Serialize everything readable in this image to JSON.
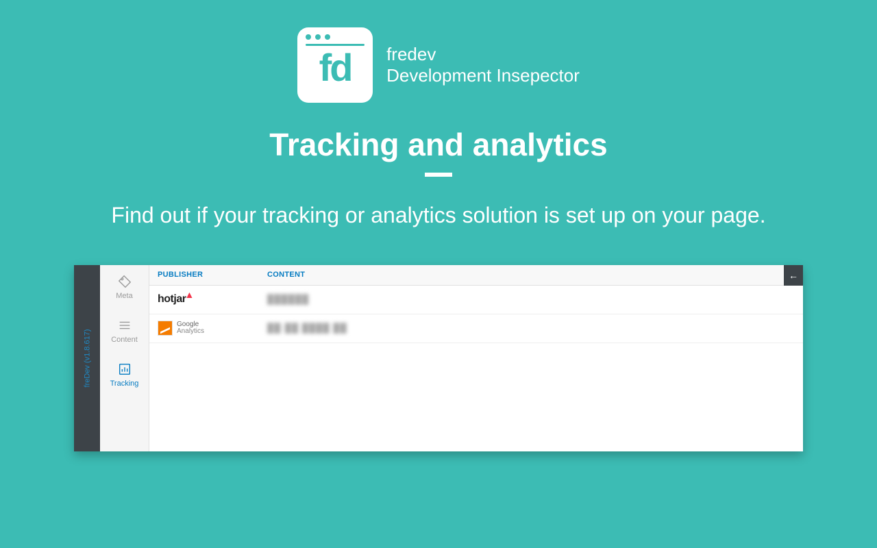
{
  "brand": {
    "line1": "fredev",
    "line2": "Development Insepector",
    "initials": "fd"
  },
  "headline": "Tracking and analytics",
  "subhead": "Find out if your tracking or analytics solution is set up on your page.",
  "sidebar": {
    "version": "freDev (v1.8.617)",
    "items": {
      "meta": "Meta",
      "content": "Content",
      "tracking": "Tracking"
    },
    "active": "tracking"
  },
  "table": {
    "headers": {
      "publisher": "PUBLISHER",
      "content": "CONTENT"
    },
    "rows": [
      {
        "publisher": "hotjar",
        "content_placeholder": "██████"
      },
      {
        "publisher": "Google Analytics",
        "content_placeholder": "██·██ ████ ██"
      }
    ]
  },
  "collapse_symbol": "←"
}
